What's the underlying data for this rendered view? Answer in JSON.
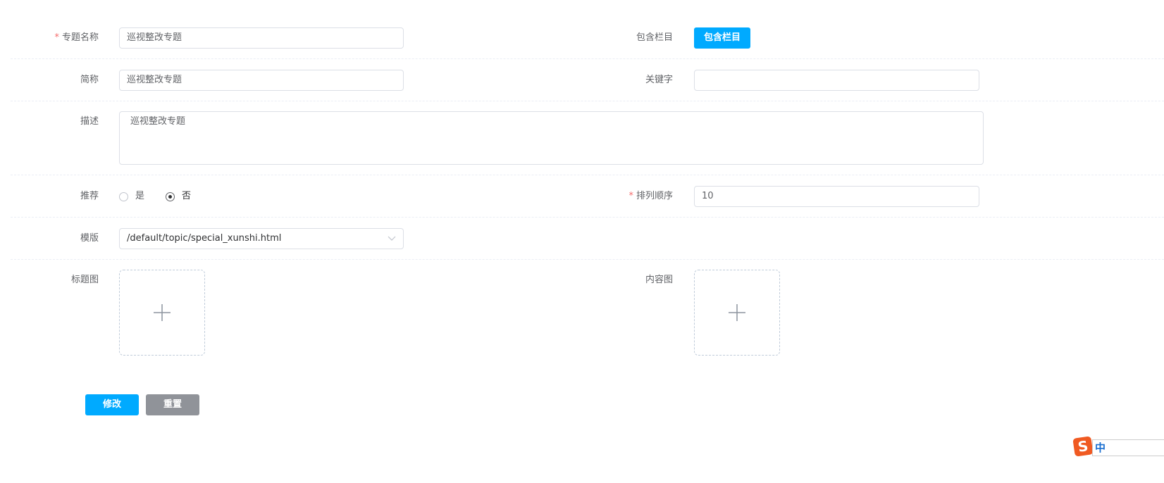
{
  "form": {
    "name": {
      "label": "专题名称",
      "value": "巡视整改专题"
    },
    "columns": {
      "label": "包含栏目",
      "button": "包含栏目"
    },
    "short": {
      "label": "简称",
      "value": "巡视整改专题"
    },
    "keyword": {
      "label": "关键字",
      "value": ""
    },
    "desc": {
      "label": "描述",
      "value": "巡视整改专题"
    },
    "recommend": {
      "label": "推荐",
      "options": [
        "是",
        "否"
      ],
      "selected": "否"
    },
    "order": {
      "label": "排列顺序",
      "value": "10"
    },
    "template": {
      "label": "模版",
      "value": "/default/topic/special_xunshi.html"
    },
    "title_image": {
      "label": "标题图"
    },
    "content_image": {
      "label": "内容图"
    }
  },
  "actions": {
    "submit": "修改",
    "reset": "重置"
  },
  "ime": {
    "label": "中"
  },
  "colors": {
    "primary": "#00aaff",
    "gray": "#909399"
  }
}
